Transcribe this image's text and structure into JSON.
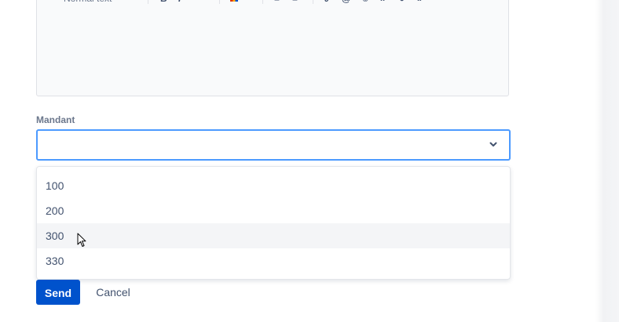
{
  "editor": {
    "toolbar": {
      "text_style": "Normal text",
      "icons": [
        "bold-icon",
        "italic-icon",
        "text-color-icon",
        "numbered-list-icon",
        "bullet-list-icon",
        "link-icon",
        "mention-icon",
        "emoji-icon",
        "code-icon",
        "info-icon",
        "quote-icon"
      ]
    }
  },
  "field": {
    "label": "Mandant",
    "value": ""
  },
  "dropdown": {
    "options": [
      "100",
      "200",
      "300",
      "330"
    ],
    "hovered_index": 2
  },
  "actions": {
    "send_label": "Send",
    "cancel_label": "Cancel"
  },
  "colors": {
    "primary": "#0052cc",
    "focus_border": "#4c9aff",
    "hover_bg": "#f4f5f7"
  }
}
